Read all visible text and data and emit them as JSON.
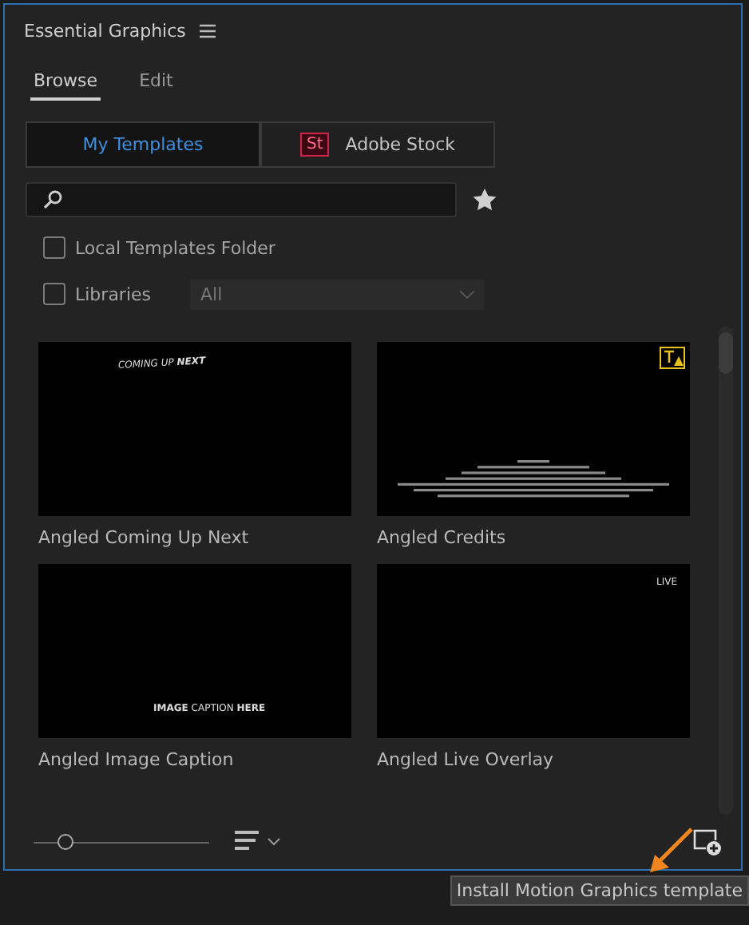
{
  "panel": {
    "title": "Essential Graphics",
    "tabs": [
      {
        "label": "Browse",
        "selected": true
      },
      {
        "label": "Edit",
        "selected": false
      }
    ],
    "source_tabs": [
      {
        "label": "My Templates",
        "selected": true,
        "kind": "plain"
      },
      {
        "label": "Adobe Stock",
        "selected": false,
        "kind": "stock",
        "badge": "St"
      }
    ],
    "checkboxes": [
      {
        "label": "Local Templates Folder",
        "checked": false
      },
      {
        "label": "Libraries",
        "checked": false
      }
    ],
    "libraries_dropdown": {
      "value": "All",
      "disabled": true
    },
    "templates": [
      {
        "name": "Angled Coming Up Next",
        "kind": "top_caption",
        "caption": "COMING UP **NEXT**",
        "warning": false
      },
      {
        "name": "Angled Credits",
        "kind": "credits",
        "warning": true
      },
      {
        "name": "Angled Image Caption",
        "kind": "bottom_caption",
        "caption": "**IMAGE** CAPTION **HERE**",
        "warning": false
      },
      {
        "name": "Angled Live Overlay",
        "kind": "corner_caption",
        "caption": "LIVE",
        "warning": false
      }
    ],
    "thumbnail_size": {
      "level": 0.18
    }
  },
  "tooltip": "Install Motion Graphics template"
}
